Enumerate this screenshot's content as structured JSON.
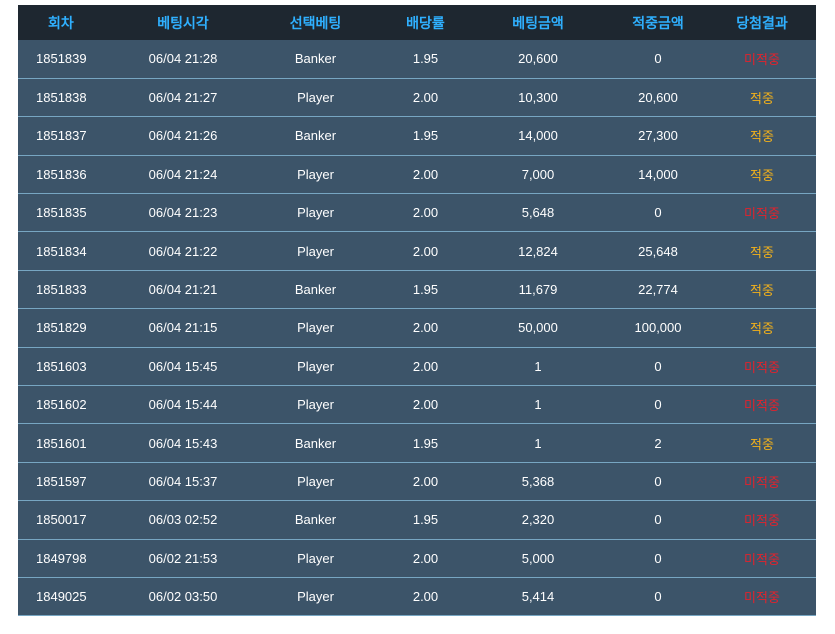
{
  "table": {
    "headers": [
      "회차",
      "베팅시각",
      "선택베팅",
      "배당률",
      "베팅금액",
      "적중금액",
      "당첨결과"
    ],
    "rows": [
      {
        "round": "1851839",
        "time": "06/04 21:28",
        "pick": "Banker",
        "odds": "1.95",
        "bet": "20,600",
        "payout": "0",
        "result": "미적중",
        "result_type": "lose"
      },
      {
        "round": "1851838",
        "time": "06/04 21:27",
        "pick": "Player",
        "odds": "2.00",
        "bet": "10,300",
        "payout": "20,600",
        "result": "적중",
        "result_type": "win"
      },
      {
        "round": "1851837",
        "time": "06/04 21:26",
        "pick": "Banker",
        "odds": "1.95",
        "bet": "14,000",
        "payout": "27,300",
        "result": "적중",
        "result_type": "win"
      },
      {
        "round": "1851836",
        "time": "06/04 21:24",
        "pick": "Player",
        "odds": "2.00",
        "bet": "7,000",
        "payout": "14,000",
        "result": "적중",
        "result_type": "win"
      },
      {
        "round": "1851835",
        "time": "06/04 21:23",
        "pick": "Player",
        "odds": "2.00",
        "bet": "5,648",
        "payout": "0",
        "result": "미적중",
        "result_type": "lose"
      },
      {
        "round": "1851834",
        "time": "06/04 21:22",
        "pick": "Player",
        "odds": "2.00",
        "bet": "12,824",
        "payout": "25,648",
        "result": "적중",
        "result_type": "win"
      },
      {
        "round": "1851833",
        "time": "06/04 21:21",
        "pick": "Banker",
        "odds": "1.95",
        "bet": "11,679",
        "payout": "22,774",
        "result": "적중",
        "result_type": "win"
      },
      {
        "round": "1851829",
        "time": "06/04 21:15",
        "pick": "Player",
        "odds": "2.00",
        "bet": "50,000",
        "payout": "100,000",
        "result": "적중",
        "result_type": "win"
      },
      {
        "round": "1851603",
        "time": "06/04 15:45",
        "pick": "Player",
        "odds": "2.00",
        "bet": "1",
        "payout": "0",
        "result": "미적중",
        "result_type": "lose"
      },
      {
        "round": "1851602",
        "time": "06/04 15:44",
        "pick": "Player",
        "odds": "2.00",
        "bet": "1",
        "payout": "0",
        "result": "미적중",
        "result_type": "lose"
      },
      {
        "round": "1851601",
        "time": "06/04 15:43",
        "pick": "Banker",
        "odds": "1.95",
        "bet": "1",
        "payout": "2",
        "result": "적중",
        "result_type": "win"
      },
      {
        "round": "1851597",
        "time": "06/04 15:37",
        "pick": "Player",
        "odds": "2.00",
        "bet": "5,368",
        "payout": "0",
        "result": "미적중",
        "result_type": "lose"
      },
      {
        "round": "1850017",
        "time": "06/03 02:52",
        "pick": "Banker",
        "odds": "1.95",
        "bet": "2,320",
        "payout": "0",
        "result": "미적중",
        "result_type": "lose"
      },
      {
        "round": "1849798",
        "time": "06/02 21:53",
        "pick": "Player",
        "odds": "2.00",
        "bet": "5,000",
        "payout": "0",
        "result": "미적중",
        "result_type": "lose"
      },
      {
        "round": "1849025",
        "time": "06/02 03:50",
        "pick": "Player",
        "odds": "2.00",
        "bet": "5,414",
        "payout": "0",
        "result": "미적중",
        "result_type": "lose"
      }
    ]
  },
  "colors": {
    "header_bg": "#1e2730",
    "header_text": "#2fb0ff",
    "row_bg": "#3c5469",
    "row_border": "#77a6c2",
    "win": "#f2b11b",
    "lose": "#e3222c"
  }
}
